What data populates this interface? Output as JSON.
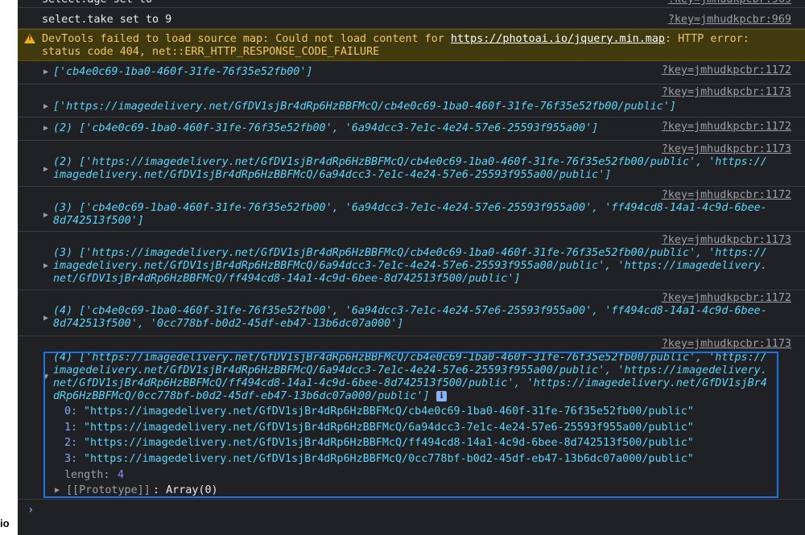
{
  "sidebar_label": "io",
  "messages": {
    "age_set": "select.age set to",
    "take_set": "select.take set to 9",
    "src_969": "?key=jmhudkpcbr:969",
    "src_1172": "?key=jmhudkpcbr:1172",
    "src_1173": "?key=jmhudkpcbr:1173"
  },
  "warning": {
    "icon": "warning-triangle-icon",
    "line1_prefix": "DevTools failed to load source map: Could not load content for ",
    "url": "https://photoai.io/jquery.min.map",
    "line1_suffix": ": HTTP error:",
    "line2": "status code 404, net::ERR_HTTP_RESPONSE_CODE_FAILURE"
  },
  "logs": {
    "r1": "['cb4e0c69-1ba0-460f-31fe-76f35e52fb00']",
    "r2": "['https://imagedelivery.net/GfDV1sjBr4dRp6HzBBFMcQ/cb4e0c69-1ba0-460f-31fe-76f35e52fb00/public']",
    "r3": "(2) ['cb4e0c69-1ba0-460f-31fe-76f35e52fb00', '6a94dcc3-7e1c-4e24-57e6-25593f955a00']",
    "r4_l1": "(2) ['https://imagedelivery.net/GfDV1sjBr4dRp6HzBBFMcQ/cb4e0c69-1ba0-460f-31fe-76f35e52fb00/public', 'https://",
    "r4_l2": "imagedelivery.net/GfDV1sjBr4dRp6HzBBFMcQ/6a94dcc3-7e1c-4e24-57e6-25593f955a00/public']",
    "r5_l1": "(3) ['cb4e0c69-1ba0-460f-31fe-76f35e52fb00', '6a94dcc3-7e1c-4e24-57e6-25593f955a00', 'ff494cd8-14a1-4c9d-6bee-",
    "r5_l2": "8d742513f500']",
    "r6_l1": "(3) ['https://imagedelivery.net/GfDV1sjBr4dRp6HzBBFMcQ/cb4e0c69-1ba0-460f-31fe-76f35e52fb00/public', 'https://",
    "r6_l2": "imagedelivery.net/GfDV1sjBr4dRp6HzBBFMcQ/6a94dcc3-7e1c-4e24-57e6-25593f955a00/public', 'https://imagedelivery.",
    "r6_l3": "net/GfDV1sjBr4dRp6HzBBFMcQ/ff494cd8-14a1-4c9d-6bee-8d742513f500/public']",
    "r7_l1": "(4) ['cb4e0c69-1ba0-460f-31fe-76f35e52fb00', '6a94dcc3-7e1c-4e24-57e6-25593f955a00', 'ff494cd8-14a1-4c9d-6bee-",
    "r7_l2": "8d742513f500', '0cc778bf-b0d2-45df-eb47-13b6dc07a000']",
    "r8_l1": "(4) ['https://imagedelivery.net/GfDV1sjBr4dRp6HzBBFMcQ/cb4e0c69-1ba0-460f-31fe-76f35e52fb00/public', 'https://",
    "r8_l2": "imagedelivery.net/GfDV1sjBr4dRp6HzBBFMcQ/6a94dcc3-7e1c-4e24-57e6-25593f955a00/public', 'https://imagedelivery.",
    "r8_l3": "net/GfDV1sjBr4dRp6HzBBFMcQ/ff494cd8-14a1-4c9d-6bee-8d742513f500/public', 'https://imagedelivery.net/GfDV1sjBr4",
    "r8_l4": "dRp6HzBBFMcQ/0cc778bf-b0d2-45df-eb47-13b6dc07a000/public']"
  },
  "expanded": {
    "entries": [
      {
        "idx": "0:",
        "val": "\"https://imagedelivery.net/GfDV1sjBr4dRp6HzBBFMcQ/cb4e0c69-1ba0-460f-31fe-76f35e52fb00/public\""
      },
      {
        "idx": "1:",
        "val": "\"https://imagedelivery.net/GfDV1sjBr4dRp6HzBBFMcQ/6a94dcc3-7e1c-4e24-57e6-25593f955a00/public\""
      },
      {
        "idx": "2:",
        "val": "\"https://imagedelivery.net/GfDV1sjBr4dRp6HzBBFMcQ/ff494cd8-14a1-4c9d-6bee-8d742513f500/public\""
      },
      {
        "idx": "3:",
        "val": "\"https://imagedelivery.net/GfDV1sjBr4dRp6HzBBFMcQ/0cc778bf-b0d2-45df-eb47-13b6dc07a000/public\""
      }
    ],
    "length_key": "length:",
    "length_val": "4",
    "proto_key": "[[Prototype]]",
    "proto_val": ": Array(0)"
  },
  "info_badge": "i",
  "prompt_glyph": "›",
  "colors": {
    "background": "#202124",
    "string": "#5cd5fb",
    "number": "#9980ff",
    "warning_bg": "#413a0f",
    "warning_text": "#f2c46d",
    "selection": "#1a73e8"
  }
}
